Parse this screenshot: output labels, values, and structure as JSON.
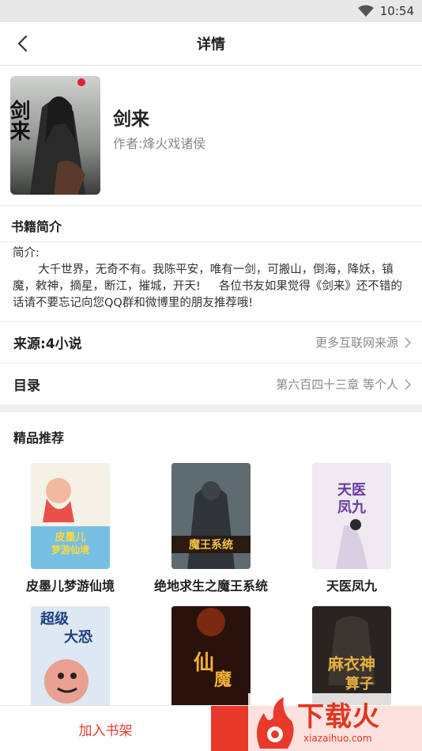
{
  "status_bar": {
    "time": "10:54"
  },
  "header": {
    "title": "详情"
  },
  "book": {
    "title": "剑来",
    "author": "作者:烽火戏诸侯",
    "cover_text": "剑来"
  },
  "intro": {
    "heading": "书籍简介",
    "text": "简介:\n       大千世界，无奇不有。我陈平安，唯有一剑，可搬山，倒海，降妖，镇魔，敕神，摘星，断江，摧城，开天!     各位书友如果觉得《剑来》还不错的话请不要忘记向您QQ群和微博里的朋友推荐哦!"
  },
  "source": {
    "label": "来源:4小说",
    "value": "更多互联网来源"
  },
  "catalog": {
    "label": "目录",
    "value": "第六百四十三章 等个人"
  },
  "recommend": {
    "heading": "精品推荐",
    "items": [
      {
        "title": "皮墨儿梦游仙境",
        "cover_text": "皮墨儿梦游仙境",
        "cover_color": "#7fc7e8"
      },
      {
        "title": "绝地求生之魔王系统",
        "cover_text": "魔王系统",
        "cover_color": "#3c4650"
      },
      {
        "title": "天医凤九",
        "cover_text": "天医凤九",
        "cover_color": "#ebe4ef"
      },
      {
        "title": "",
        "cover_text": "超级大恐怖",
        "cover_color": "#a8c4e0"
      },
      {
        "title": "",
        "cover_text": "仙魔",
        "cover_color": "#3a1c14"
      },
      {
        "title": "",
        "cover_text": "麻衣神算子",
        "cover_color": "#2c2620"
      }
    ]
  },
  "bottom": {
    "add_shelf": "加入书架"
  },
  "watermark": {
    "text": "下载火",
    "url": "xiazaihuo.com"
  },
  "colors": {
    "accent": "#e8392b"
  }
}
